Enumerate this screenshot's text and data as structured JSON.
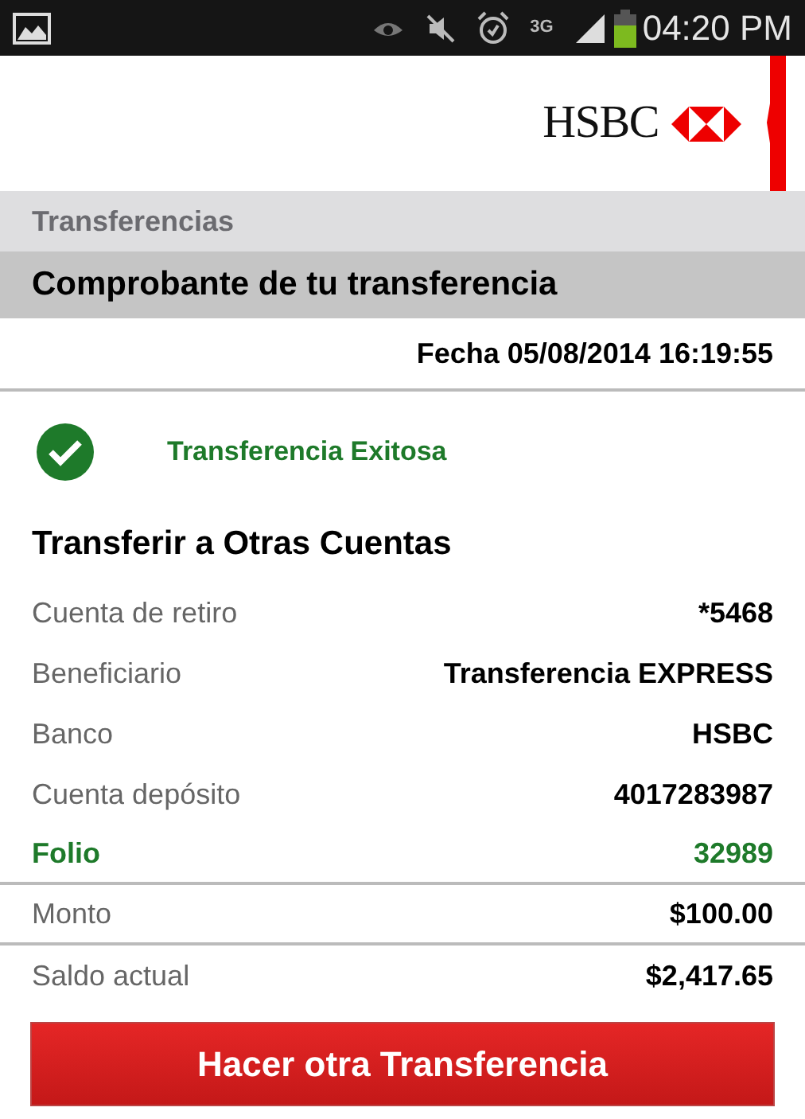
{
  "status_bar": {
    "network": "3G",
    "time": "04:20 PM"
  },
  "header": {
    "logo_text": "HSBC"
  },
  "breadcrumb": "Transferencias",
  "title": "Comprobante de tu transferencia",
  "date": "Fecha 05/08/2014 16:19:55",
  "status": {
    "kind": "success",
    "message": "Transferencia Exitosa"
  },
  "section_title": "Transferir a Otras Cuentas",
  "rows": [
    {
      "label": "Cuenta de retiro",
      "value": "*5468",
      "highlight": false,
      "separated": false
    },
    {
      "label": "Beneficiario",
      "value": "Transferencia EXPRESS",
      "highlight": false,
      "separated": false
    },
    {
      "label": "Banco",
      "value": "HSBC",
      "highlight": false,
      "separated": false
    },
    {
      "label": "Cuenta depósito",
      "value": "4017283987",
      "highlight": false,
      "separated": false
    },
    {
      "label": "Folio",
      "value": "32989",
      "highlight": true,
      "separated": true
    },
    {
      "label": "Monto",
      "value": "$100.00",
      "highlight": false,
      "separated": true
    },
    {
      "label": "Saldo actual",
      "value": "$2,417.65",
      "highlight": false,
      "separated": false
    }
  ],
  "button": "Hacer otra Transferencia"
}
